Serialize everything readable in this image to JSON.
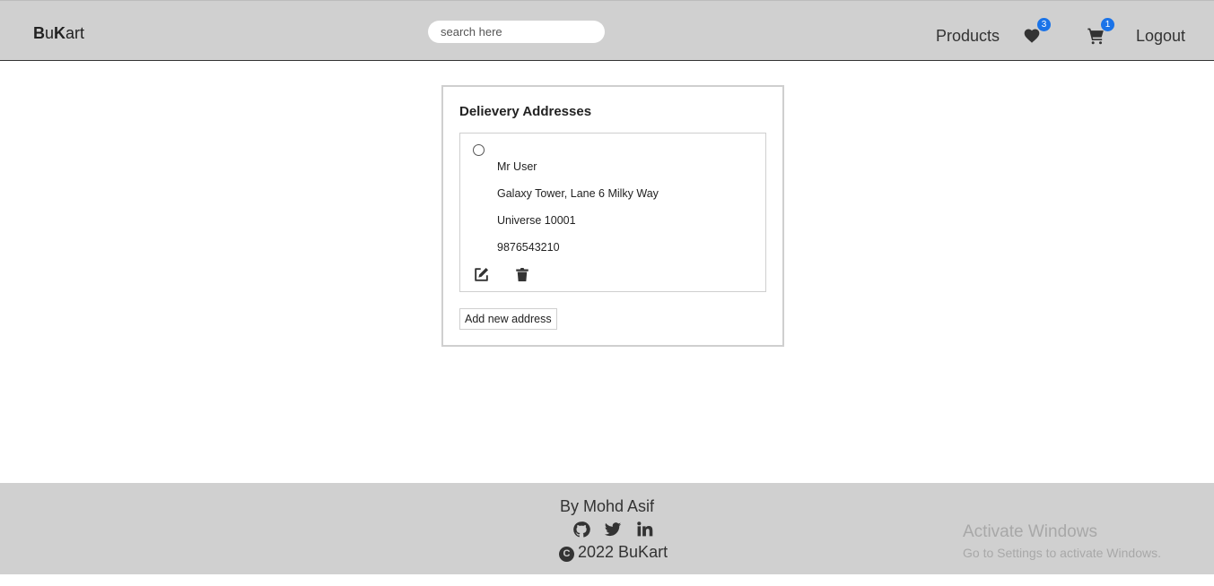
{
  "header": {
    "logo_b": "B",
    "logo_u": "u",
    "logo_k": "K",
    "logo_art": "art",
    "search_placeholder": "search here",
    "products_label": "Products",
    "wishlist_count": "3",
    "cart_count": "1",
    "logout_label": "Logout"
  },
  "addresses": {
    "title": "Delievery Addresses",
    "items": [
      {
        "name": "Mr User",
        "street": "Galaxy Tower, Lane 6 Milky Way",
        "city_zip": "Universe 10001",
        "phone": "9876543210"
      }
    ],
    "add_button": "Add new address"
  },
  "footer": {
    "byline": "By Mohd Asif",
    "copyright_symbol": "C",
    "copyright_text": "2022 BuKart"
  },
  "watermark": {
    "line1": "Activate Windows",
    "line2": "Go to Settings to activate Windows."
  },
  "icons": {
    "wishlist": "heart-icon",
    "cart": "cart-icon",
    "edit": "edit-icon",
    "delete": "trash-icon",
    "github": "github-icon",
    "twitter": "twitter-icon",
    "linkedin": "linkedin-icon"
  },
  "colors": {
    "header_bg": "#d0d0d0",
    "badge": "#1a73e8",
    "footer_bg": "#d0d0d0"
  }
}
